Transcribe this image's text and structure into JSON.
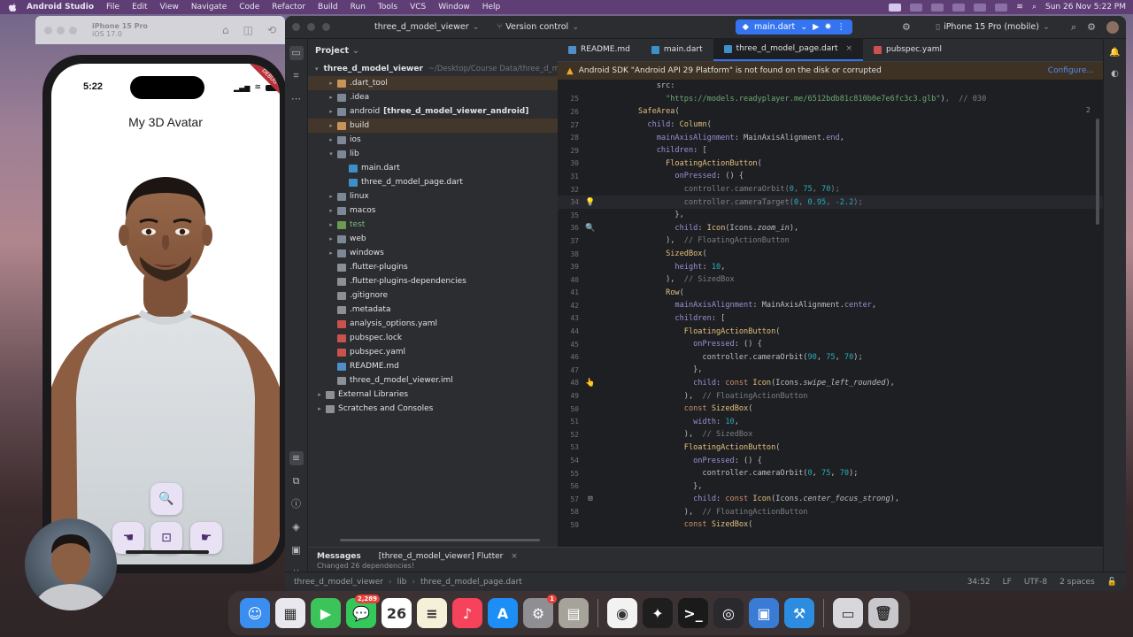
{
  "menubar": {
    "app_name": "Android Studio",
    "items": [
      "File",
      "Edit",
      "View",
      "Navigate",
      "Code",
      "Refactor",
      "Build",
      "Run",
      "Tools",
      "VCS",
      "Window",
      "Help"
    ],
    "clock": "Sun 26 Nov  5:22 PM"
  },
  "simulator": {
    "device_name": "iPhone 15 Pro",
    "os": "iOS 17.0"
  },
  "phone": {
    "time": "5:22",
    "title": "My 3D Avatar",
    "debug_banner": "DEBUG",
    "buttons": [
      {
        "icon": "zoom-in-icon",
        "glyph": "🔍"
      },
      {
        "icon": "swipe-left-icon",
        "glyph": "☚"
      },
      {
        "icon": "center-focus-icon",
        "glyph": "⊡"
      },
      {
        "icon": "swipe-right-icon",
        "glyph": "☛"
      }
    ]
  },
  "ide": {
    "project_name": "three_d_model_viewer",
    "version_control": "Version control",
    "run_config": "main.dart",
    "device_selector": "iPhone 15 Pro (mobile)",
    "project_panel_title": "Project",
    "tree": [
      {
        "label": "three_d_model_viewer",
        "extra": "~/Desktop/Course Data/three_d_model_viewer",
        "type": "folder-o",
        "depth": 0,
        "open": true,
        "bold": true
      },
      {
        "label": ".dart_tool",
        "type": "folder-o",
        "depth": 1,
        "arrow": true,
        "hl": "brown"
      },
      {
        "label": ".idea",
        "type": "folder",
        "depth": 1,
        "arrow": true
      },
      {
        "label": "android",
        "extra_bold": "[three_d_model_viewer_android]",
        "type": "folder",
        "depth": 1,
        "arrow": true
      },
      {
        "label": "build",
        "type": "folder-o",
        "depth": 1,
        "arrow": true,
        "hl": "brown"
      },
      {
        "label": "ios",
        "type": "folder",
        "depth": 1,
        "arrow": true
      },
      {
        "label": "lib",
        "type": "folder",
        "depth": 1,
        "open": true
      },
      {
        "label": "main.dart",
        "type": "dart",
        "depth": 2
      },
      {
        "label": "three_d_model_page.dart",
        "type": "dart",
        "depth": 2
      },
      {
        "label": "linux",
        "type": "folder",
        "depth": 1,
        "arrow": true
      },
      {
        "label": "macos",
        "type": "folder",
        "depth": 1,
        "arrow": true
      },
      {
        "label": "test",
        "type": "folder-g",
        "depth": 1,
        "arrow": true,
        "hl": "green"
      },
      {
        "label": "web",
        "type": "folder",
        "depth": 1,
        "arrow": true
      },
      {
        "label": "windows",
        "type": "folder",
        "depth": 1,
        "arrow": true
      },
      {
        "label": ".flutter-plugins",
        "type": "iml",
        "depth": 1
      },
      {
        "label": ".flutter-plugins-dependencies",
        "type": "iml",
        "depth": 1
      },
      {
        "label": ".gitignore",
        "type": "gi",
        "depth": 1
      },
      {
        "label": ".metadata",
        "type": "iml",
        "depth": 1
      },
      {
        "label": "analysis_options.yaml",
        "type": "yaml",
        "depth": 1
      },
      {
        "label": "pubspec.lock",
        "type": "yaml",
        "depth": 1
      },
      {
        "label": "pubspec.yaml",
        "type": "yaml",
        "depth": 1
      },
      {
        "label": "README.md",
        "type": "md",
        "depth": 1
      },
      {
        "label": "three_d_model_viewer.iml",
        "type": "iml",
        "depth": 1
      },
      {
        "label": "External Libraries",
        "type": "iml",
        "depth": 0,
        "arrow": true
      },
      {
        "label": "Scratches and Consoles",
        "type": "iml",
        "depth": 0,
        "arrow": true
      }
    ],
    "tabs": [
      {
        "label": "README.md",
        "icon": "md"
      },
      {
        "label": "main.dart",
        "icon": "dart"
      },
      {
        "label": "three_d_model_page.dart",
        "icon": "dart",
        "active": true
      },
      {
        "label": "pubspec.yaml",
        "icon": "yaml"
      }
    ],
    "warning": "Android SDK \"Android API 29 Platform\" is not found on the disk or corrupted",
    "warning_action": "Configure...",
    "code_lines": [
      {
        "n": "",
        "t": [
          [
            "c",
            "          src:"
          ]
        ]
      },
      {
        "n": "25",
        "t": [
          [
            "s",
            "            \"https://models.readyplayer.me/6512bdb81c810b0e7e6fc3c3.glb\""
          ],
          [
            "c",
            ")"
          ],
          [
            "cm",
            ",  // 030"
          ]
        ]
      },
      {
        "n": "26",
        "t": [
          [
            "cls",
            "      SafeArea"
          ],
          [
            "c",
            "("
          ]
        ]
      },
      {
        "n": "27",
        "t": [
          [
            "p",
            "        child"
          ],
          [
            "c",
            ": "
          ],
          [
            "cls",
            "Column"
          ],
          [
            "c",
            "("
          ]
        ]
      },
      {
        "n": "28",
        "t": [
          [
            "p",
            "          mainAxisAlignment"
          ],
          [
            "c",
            ": MainAxisAlignment."
          ],
          [
            "p",
            "end"
          ],
          [
            "c",
            ","
          ]
        ]
      },
      {
        "n": "29",
        "t": [
          [
            "p",
            "          children"
          ],
          [
            "c",
            ": ["
          ]
        ]
      },
      {
        "n": "30",
        "t": [
          [
            "cls",
            "            FloatingActionButton"
          ],
          [
            "c",
            "("
          ]
        ]
      },
      {
        "n": "31",
        "t": [
          [
            "p",
            "              onPressed"
          ],
          [
            "c",
            ": () {"
          ]
        ]
      },
      {
        "n": "32",
        "t": [
          [
            "lt",
            "                controller.cameraOrbit("
          ],
          [
            "n",
            "0"
          ],
          [
            "lt",
            ", "
          ],
          [
            "n",
            "75"
          ],
          [
            "lt",
            ", "
          ],
          [
            "n",
            "70"
          ],
          [
            "lt",
            ");"
          ]
        ]
      },
      {
        "n": "34",
        "t": [
          [
            "lt",
            "                controller.cameraTarget("
          ],
          [
            "n",
            "0"
          ],
          [
            "lt",
            ", "
          ],
          [
            "n",
            "0.95"
          ],
          [
            "lt",
            ", "
          ],
          [
            "n",
            "-2.2"
          ],
          [
            "lt",
            ");"
          ]
        ],
        "cur": true,
        "gut": "💡"
      },
      {
        "n": "35",
        "t": [
          [
            "c",
            "              },"
          ]
        ]
      },
      {
        "n": "36",
        "t": [
          [
            "p",
            "              child"
          ],
          [
            "c",
            ": "
          ],
          [
            "cls",
            "Icon"
          ],
          [
            "c",
            "(Icons."
          ],
          [
            "it",
            "zoom_in"
          ],
          [
            "c",
            "),"
          ]
        ],
        "gut": "🔍"
      },
      {
        "n": "37",
        "t": [
          [
            "c",
            "            ), "
          ],
          [
            "cm",
            " // FloatingActionButton"
          ]
        ]
      },
      {
        "n": "38",
        "t": [
          [
            "cls",
            "            SizedBox"
          ],
          [
            "c",
            "("
          ]
        ]
      },
      {
        "n": "39",
        "t": [
          [
            "p",
            "              height"
          ],
          [
            "c",
            ": "
          ],
          [
            "n",
            "10"
          ],
          [
            "c",
            ","
          ]
        ]
      },
      {
        "n": "40",
        "t": [
          [
            "c",
            "            ), "
          ],
          [
            "cm",
            " // SizedBox"
          ]
        ]
      },
      {
        "n": "41",
        "t": [
          [
            "cls",
            "            Row"
          ],
          [
            "c",
            "("
          ]
        ]
      },
      {
        "n": "42",
        "t": [
          [
            "p",
            "              mainAxisAlignment"
          ],
          [
            "c",
            ": MainAxisAlignment."
          ],
          [
            "p",
            "center"
          ],
          [
            "c",
            ","
          ]
        ]
      },
      {
        "n": "43",
        "t": [
          [
            "p",
            "              children"
          ],
          [
            "c",
            ": ["
          ]
        ]
      },
      {
        "n": "44",
        "t": [
          [
            "cls",
            "                FloatingActionButton"
          ],
          [
            "c",
            "("
          ]
        ]
      },
      {
        "n": "45",
        "t": [
          [
            "p",
            "                  onPressed"
          ],
          [
            "c",
            ": () {"
          ]
        ]
      },
      {
        "n": "46",
        "t": [
          [
            "c",
            "                    controller.cameraOrbit("
          ],
          [
            "n",
            "90"
          ],
          [
            "c",
            ", "
          ],
          [
            "n",
            "75"
          ],
          [
            "c",
            ", "
          ],
          [
            "n",
            "70"
          ],
          [
            "c",
            ");"
          ]
        ]
      },
      {
        "n": "47",
        "t": [
          [
            "c",
            "                  },"
          ]
        ]
      },
      {
        "n": "48",
        "t": [
          [
            "p",
            "                  child"
          ],
          [
            "c",
            ": "
          ],
          [
            "k",
            "const "
          ],
          [
            "cls",
            "Icon"
          ],
          [
            "c",
            "(Icons."
          ],
          [
            "it",
            "swipe_left_rounded"
          ],
          [
            "c",
            "),"
          ]
        ],
        "gut": "👆"
      },
      {
        "n": "49",
        "t": [
          [
            "c",
            "                ), "
          ],
          [
            "cm",
            " // FloatingActionButton"
          ]
        ]
      },
      {
        "n": "50",
        "t": [
          [
            "k",
            "                const "
          ],
          [
            "cls",
            "SizedBox"
          ],
          [
            "c",
            "("
          ]
        ]
      },
      {
        "n": "51",
        "t": [
          [
            "p",
            "                  width"
          ],
          [
            "c",
            ": "
          ],
          [
            "n",
            "10"
          ],
          [
            "c",
            ","
          ]
        ]
      },
      {
        "n": "52",
        "t": [
          [
            "c",
            "                ), "
          ],
          [
            "cm",
            " // SizedBox"
          ]
        ]
      },
      {
        "n": "53",
        "t": [
          [
            "cls",
            "                FloatingActionButton"
          ],
          [
            "c",
            "("
          ]
        ]
      },
      {
        "n": "54",
        "t": [
          [
            "p",
            "                  onPressed"
          ],
          [
            "c",
            ": () {"
          ]
        ]
      },
      {
        "n": "55",
        "t": [
          [
            "c",
            "                    controller.cameraOrbit("
          ],
          [
            "n",
            "0"
          ],
          [
            "c",
            ", "
          ],
          [
            "n",
            "75"
          ],
          [
            "c",
            ", "
          ],
          [
            "n",
            "70"
          ],
          [
            "c",
            ");"
          ]
        ]
      },
      {
        "n": "56",
        "t": [
          [
            "c",
            "                  },"
          ]
        ]
      },
      {
        "n": "57",
        "t": [
          [
            "p",
            "                  child"
          ],
          [
            "c",
            ": "
          ],
          [
            "k",
            "const "
          ],
          [
            "cls",
            "Icon"
          ],
          [
            "c",
            "(Icons."
          ],
          [
            "it",
            "center_focus_strong"
          ],
          [
            "c",
            "),"
          ]
        ],
        "gut": "⊡"
      },
      {
        "n": "58",
        "t": [
          [
            "c",
            "                ), "
          ],
          [
            "cm",
            " // FloatingActionButton"
          ]
        ]
      },
      {
        "n": "59",
        "t": [
          [
            "k",
            "                const "
          ],
          [
            "cls",
            "SizedBox"
          ],
          [
            "c",
            "("
          ]
        ]
      }
    ],
    "bottom_tabs": [
      "Messages",
      "[three_d_model_viewer] Flutter"
    ],
    "bottom_text": "Changed 26 dependencies!",
    "breadcrumb": [
      "three_d_model_viewer",
      "lib",
      "three_d_model_page.dart"
    ],
    "status_right": [
      "34:52",
      "LF",
      "UTF-8",
      "2 spaces"
    ],
    "inspection_badge": "2"
  },
  "dock": {
    "apps": [
      {
        "name": "Finder",
        "color": "#3a8ef0",
        "glyph": "☺"
      },
      {
        "name": "Launchpad",
        "color": "#e8e8ee",
        "glyph": "▦"
      },
      {
        "name": "FaceTime",
        "color": "#3cc45a",
        "glyph": "▶"
      },
      {
        "name": "Messages",
        "color": "#34c759",
        "glyph": "💬",
        "badge": "2,289"
      },
      {
        "name": "Calendar",
        "color": "#ffffff",
        "glyph": "26"
      },
      {
        "name": "Notes",
        "color": "#f5f0d8",
        "glyph": "≡"
      },
      {
        "name": "Music",
        "color": "#f6435b",
        "glyph": "♪"
      },
      {
        "name": "App Store",
        "color": "#1d8ef5",
        "glyph": "A"
      },
      {
        "name": "System Settings",
        "color": "#8e8e93",
        "glyph": "⚙",
        "badge": "1"
      },
      {
        "name": "Archive",
        "color": "#a6a39a",
        "glyph": "▤"
      },
      {
        "name": "Chrome",
        "color": "#f2f2f2",
        "glyph": "◉"
      },
      {
        "name": "Figma",
        "color": "#1e1e1e",
        "glyph": "✦"
      },
      {
        "name": "Terminal",
        "color": "#1a1a1a",
        "glyph": ">_"
      },
      {
        "name": "OBS",
        "color": "#2a2a2e",
        "glyph": "◎"
      },
      {
        "name": "Simulator",
        "color": "#3a7bd5",
        "glyph": "▣"
      },
      {
        "name": "Xcode",
        "color": "#2c8de0",
        "glyph": "⚒"
      },
      {
        "name": "Screenshot",
        "color": "#d7d7dc",
        "glyph": "▭"
      },
      {
        "name": "Trash",
        "color": "#c8c8cc",
        "glyph": "🗑"
      }
    ]
  }
}
